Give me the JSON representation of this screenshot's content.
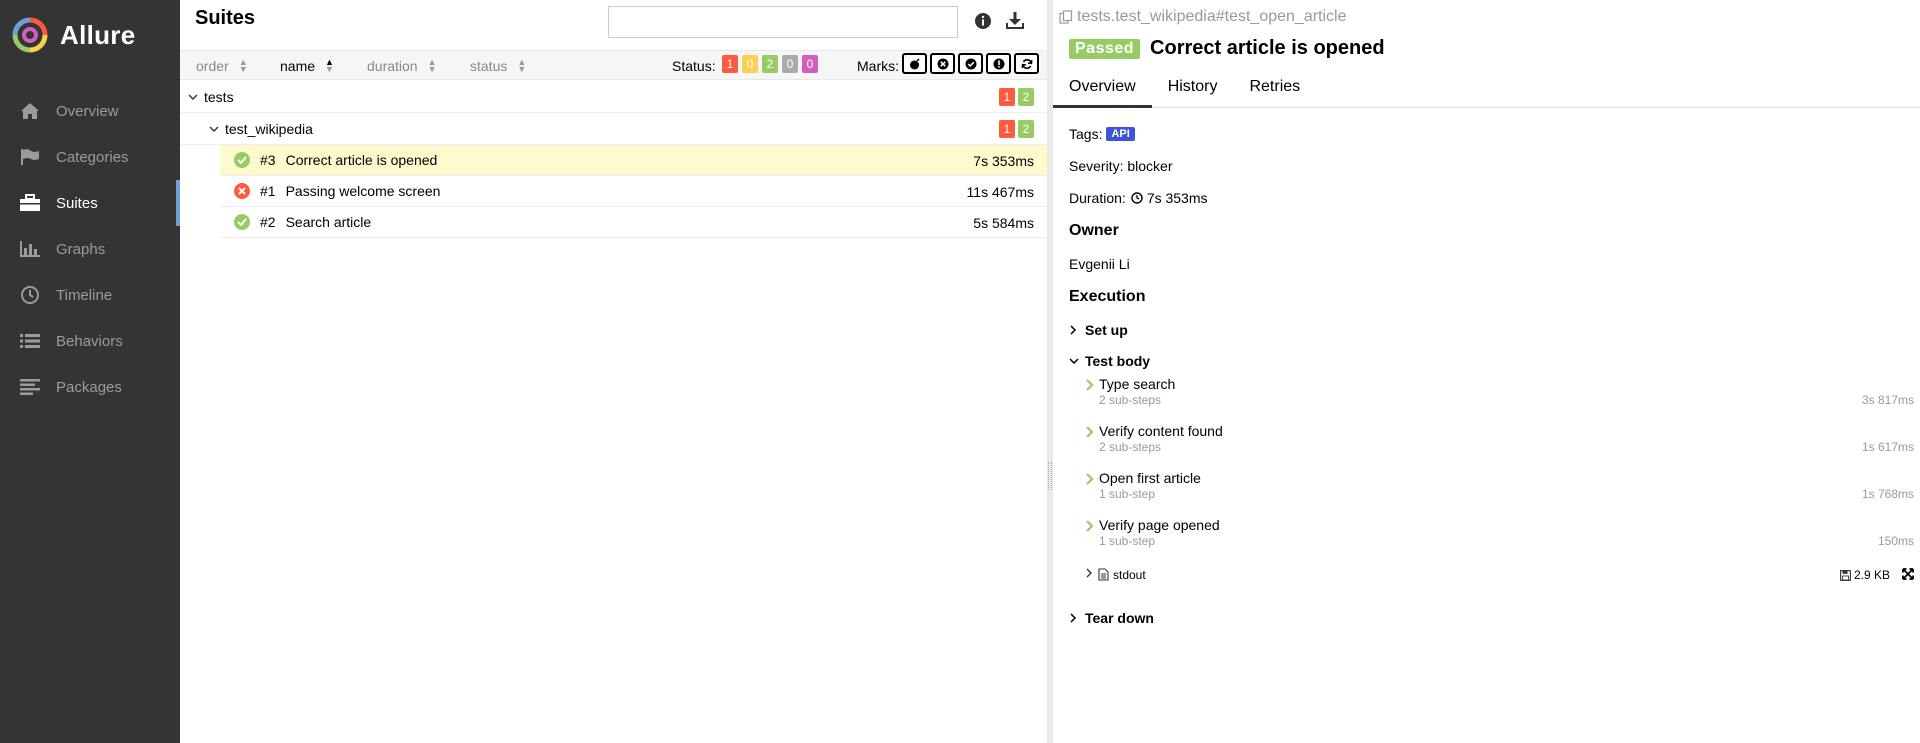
{
  "brand": {
    "name": "Allure"
  },
  "nav": [
    {
      "id": "overview",
      "label": "Overview",
      "icon": "home-icon"
    },
    {
      "id": "categories",
      "label": "Categories",
      "icon": "flag-icon"
    },
    {
      "id": "suites",
      "label": "Suites",
      "icon": "briefcase-icon",
      "active": true
    },
    {
      "id": "graphs",
      "label": "Graphs",
      "icon": "bar-chart-icon"
    },
    {
      "id": "timeline",
      "label": "Timeline",
      "icon": "clock-icon"
    },
    {
      "id": "behaviors",
      "label": "Behaviors",
      "icon": "list-icon"
    },
    {
      "id": "packages",
      "label": "Packages",
      "icon": "align-left-icon"
    }
  ],
  "suites": {
    "title": "Suites",
    "search": {
      "value": "",
      "placeholder": ""
    },
    "sort": {
      "order": "order",
      "name": "name",
      "duration": "duration",
      "status": "status"
    },
    "status_label": "Status:",
    "status_counts": {
      "failed": "1",
      "broken": "0",
      "passed": "2",
      "skipped": "0",
      "unknown": "0"
    },
    "marks_label": "Marks:",
    "tree": {
      "group": {
        "name": "tests",
        "failed": "1",
        "passed": "2"
      },
      "subgroup": {
        "name": "test_wikipedia",
        "failed": "1",
        "passed": "2"
      },
      "rows": [
        {
          "order": "#3",
          "name": "Correct article is opened",
          "duration": "7s 353ms",
          "status": "passed",
          "selected": true
        },
        {
          "order": "#1",
          "name": "Passing welcome screen",
          "duration": "11s 467ms",
          "status": "failed"
        },
        {
          "order": "#2",
          "name": "Search article",
          "duration": "5s 584ms",
          "status": "passed"
        }
      ]
    }
  },
  "detail": {
    "full_name": "tests.test_wikipedia#test_open_article",
    "status": "Passed",
    "title": "Correct article is opened",
    "tabs": [
      "Overview",
      "History",
      "Retries"
    ],
    "tags_label": "Tags:",
    "tag": "API",
    "severity": "Severity: blocker",
    "duration_label": "Duration:",
    "duration": "7s 353ms",
    "owner_heading": "Owner",
    "owner": "Evgenii Li",
    "execution_heading": "Execution",
    "setup": "Set up",
    "test_body": "Test body",
    "steps": [
      {
        "name": "Type search",
        "sub": "2 sub-steps",
        "time": "3s 817ms"
      },
      {
        "name": "Verify content found",
        "sub": "2 sub-steps",
        "time": "1s 617ms"
      },
      {
        "name": "Open first article",
        "sub": "1 sub-step",
        "time": "1s 768ms"
      },
      {
        "name": "Verify page opened",
        "sub": "1 sub-step",
        "time": "150ms"
      }
    ],
    "attachment": {
      "name": "stdout",
      "size": "2.9 KB"
    },
    "teardown": "Tear down"
  }
}
